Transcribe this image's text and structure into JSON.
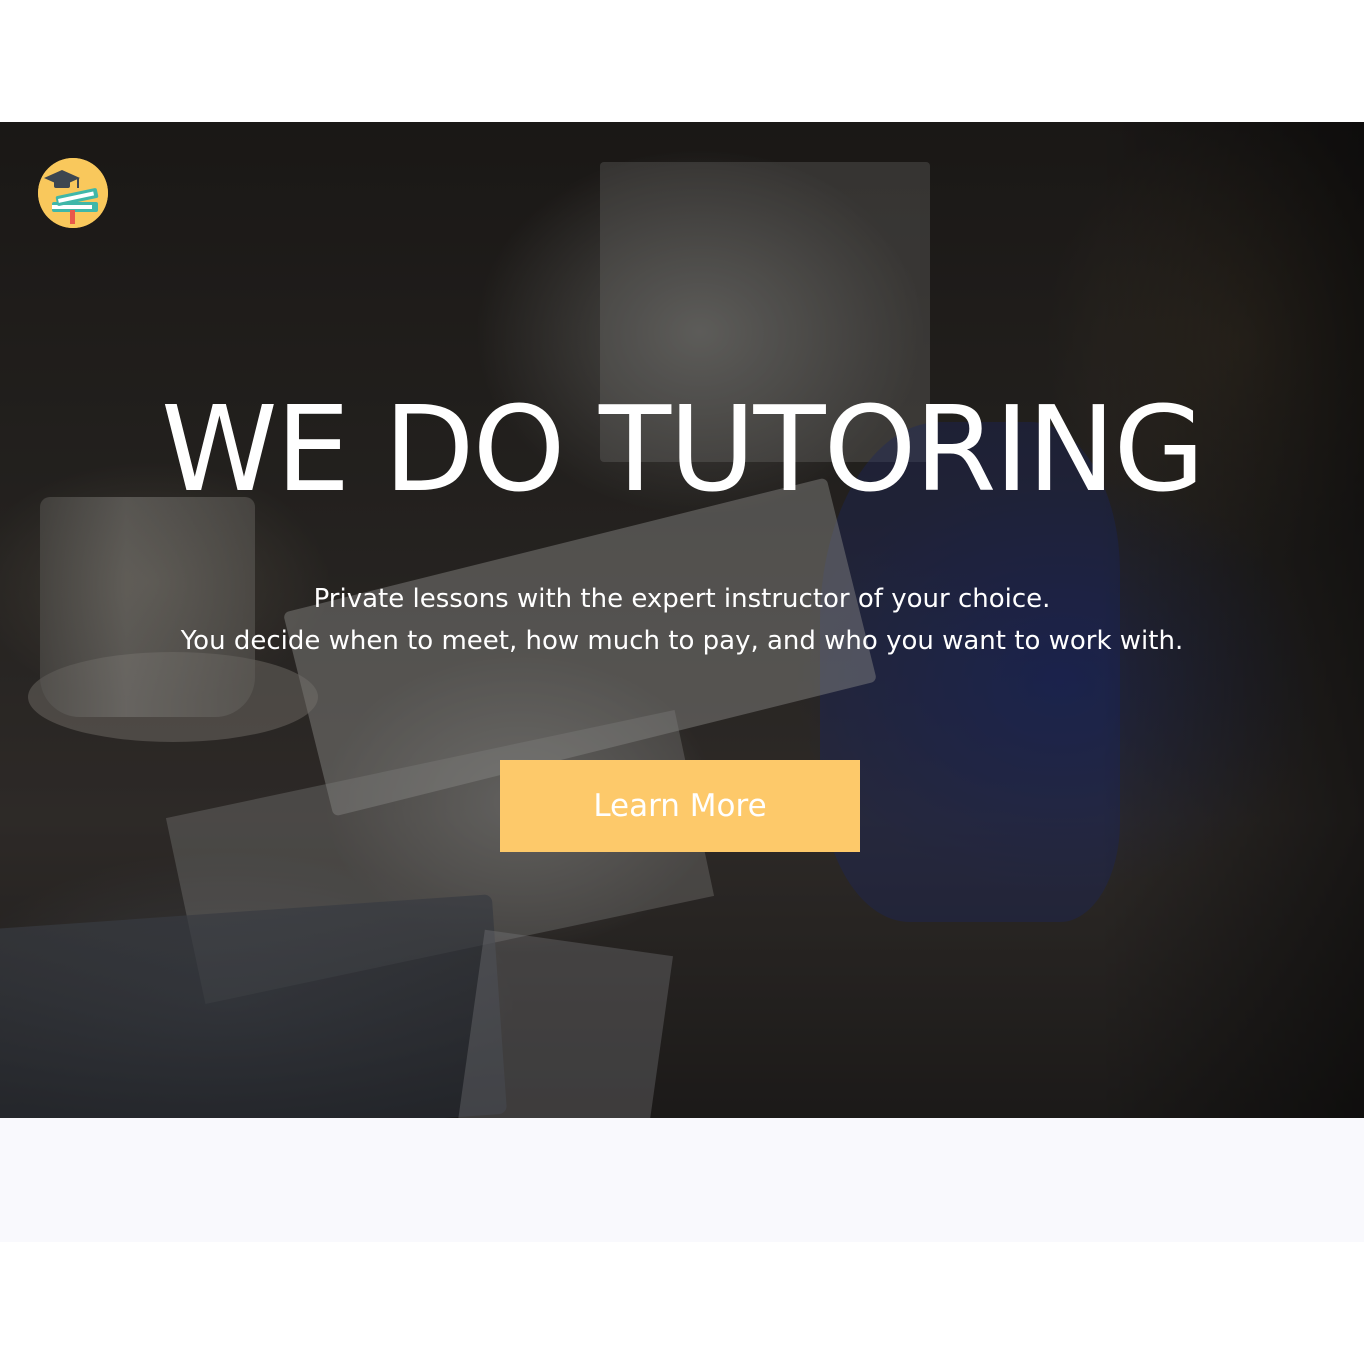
{
  "hero": {
    "headline": "WE DO TUTORING",
    "subtitle_line1": "Private lessons with the expert instructor of your choice.",
    "subtitle_line2": "You decide when to meet, how much to pay, and who you want to work with.",
    "cta_label": "Learn More",
    "logo_icon": "graduation-books-icon"
  },
  "colors": {
    "accent": "#fdc96a",
    "logo_bg": "#f9c85c",
    "text": "#ffffff",
    "light_band": "#f9f9fd"
  }
}
